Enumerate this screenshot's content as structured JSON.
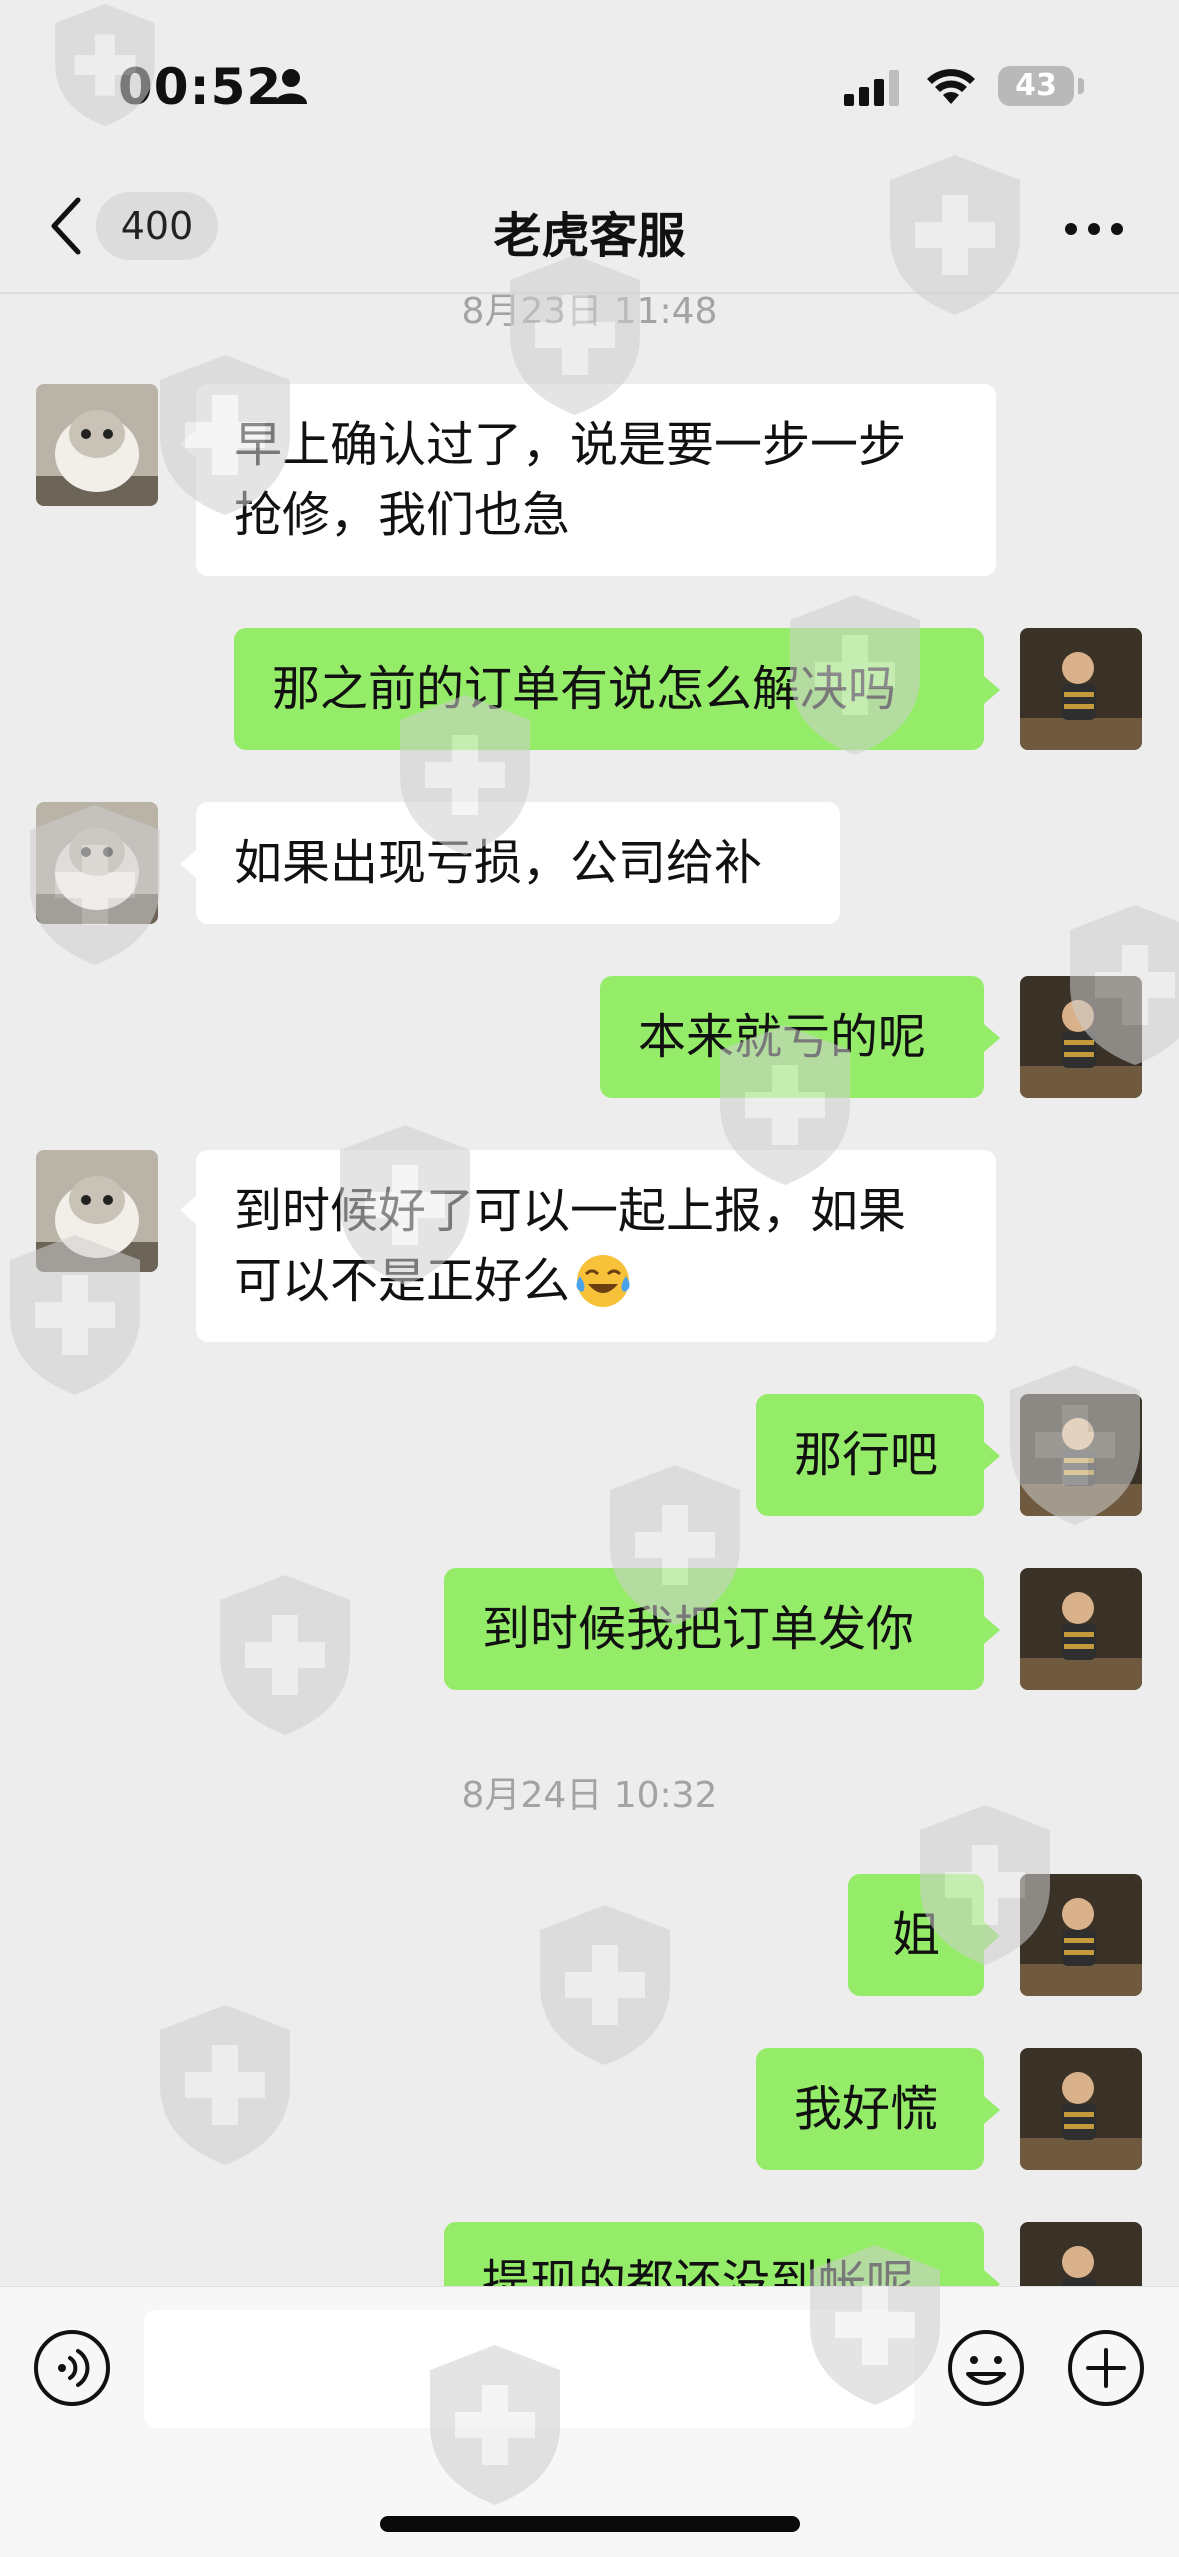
{
  "status_bar": {
    "time": "00:52",
    "battery": "43"
  },
  "nav": {
    "unread_count": "400",
    "title": "老虎客服"
  },
  "timestamps": {
    "first": "8月23日 11:48",
    "second": "8月24日 10:32"
  },
  "messages": [
    {
      "side": "in",
      "lines": [
        "早上确认过了，说是要一步一步",
        "抢修，我们也急"
      ]
    },
    {
      "side": "out",
      "text": "那之前的订单有说怎么解决吗"
    },
    {
      "side": "in",
      "text": "如果出现亏损，公司给补"
    },
    {
      "side": "out",
      "text": "本来就亏的呢"
    },
    {
      "side": "in",
      "lines": [
        "到时候好了可以一起上报，如果",
        "可以不是正好么"
      ],
      "emoji": "cry-laugh-emoji"
    },
    {
      "side": "out",
      "text": "那行吧"
    },
    {
      "side": "out",
      "text": "到时候我把订单发你"
    },
    {
      "side": "out",
      "text": "姐"
    },
    {
      "side": "out",
      "text": "我好慌"
    },
    {
      "side": "out",
      "text": "提现的都还没到帐呢"
    }
  ],
  "icons": {
    "back": "chevron-left-icon",
    "more": "more-dots-icon",
    "voice": "voice-icon",
    "emoji": "emoji-icon",
    "plus": "plus-icon"
  },
  "colors": {
    "outgoing_bubble": "#95ec69",
    "incoming_bubble": "#ffffff",
    "background": "#ededed"
  }
}
